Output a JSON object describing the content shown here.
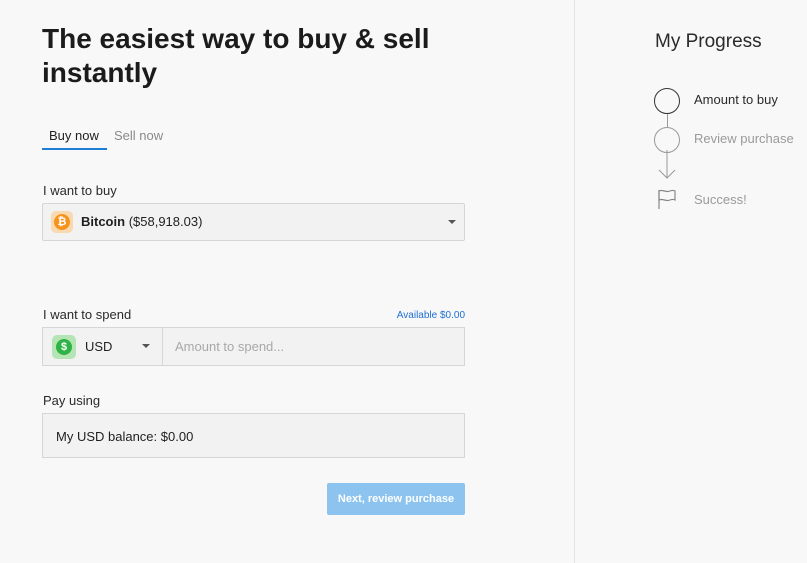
{
  "header": {
    "title": "The easiest way to buy & sell instantly"
  },
  "tabs": [
    {
      "label": "Buy now",
      "active": true
    },
    {
      "label": "Sell now",
      "active": false
    }
  ],
  "buy": {
    "label": "I want to buy",
    "selected_coin": "Bitcoin",
    "selected_price": "($58,918.03)",
    "icon": "bitcoin-icon"
  },
  "spend": {
    "label": "I want to spend",
    "available": "Available $0.00",
    "currency": "USD",
    "currency_icon": "dollar-icon",
    "placeholder": "Amount to spend..."
  },
  "pay": {
    "label": "Pay using",
    "value": "My USD balance: $0.00"
  },
  "actions": {
    "next_label": "Next, review purchase"
  },
  "progress": {
    "title": "My Progress",
    "steps": [
      {
        "label": "Amount to buy",
        "state": "active"
      },
      {
        "label": "Review purchase",
        "state": "pending"
      },
      {
        "label": "Success!",
        "state": "pending"
      }
    ]
  },
  "colors": {
    "accent": "#1e7ed4",
    "button": "#8cc4ef",
    "bitcoin": "#f7931a",
    "usd": "#2fb344"
  }
}
